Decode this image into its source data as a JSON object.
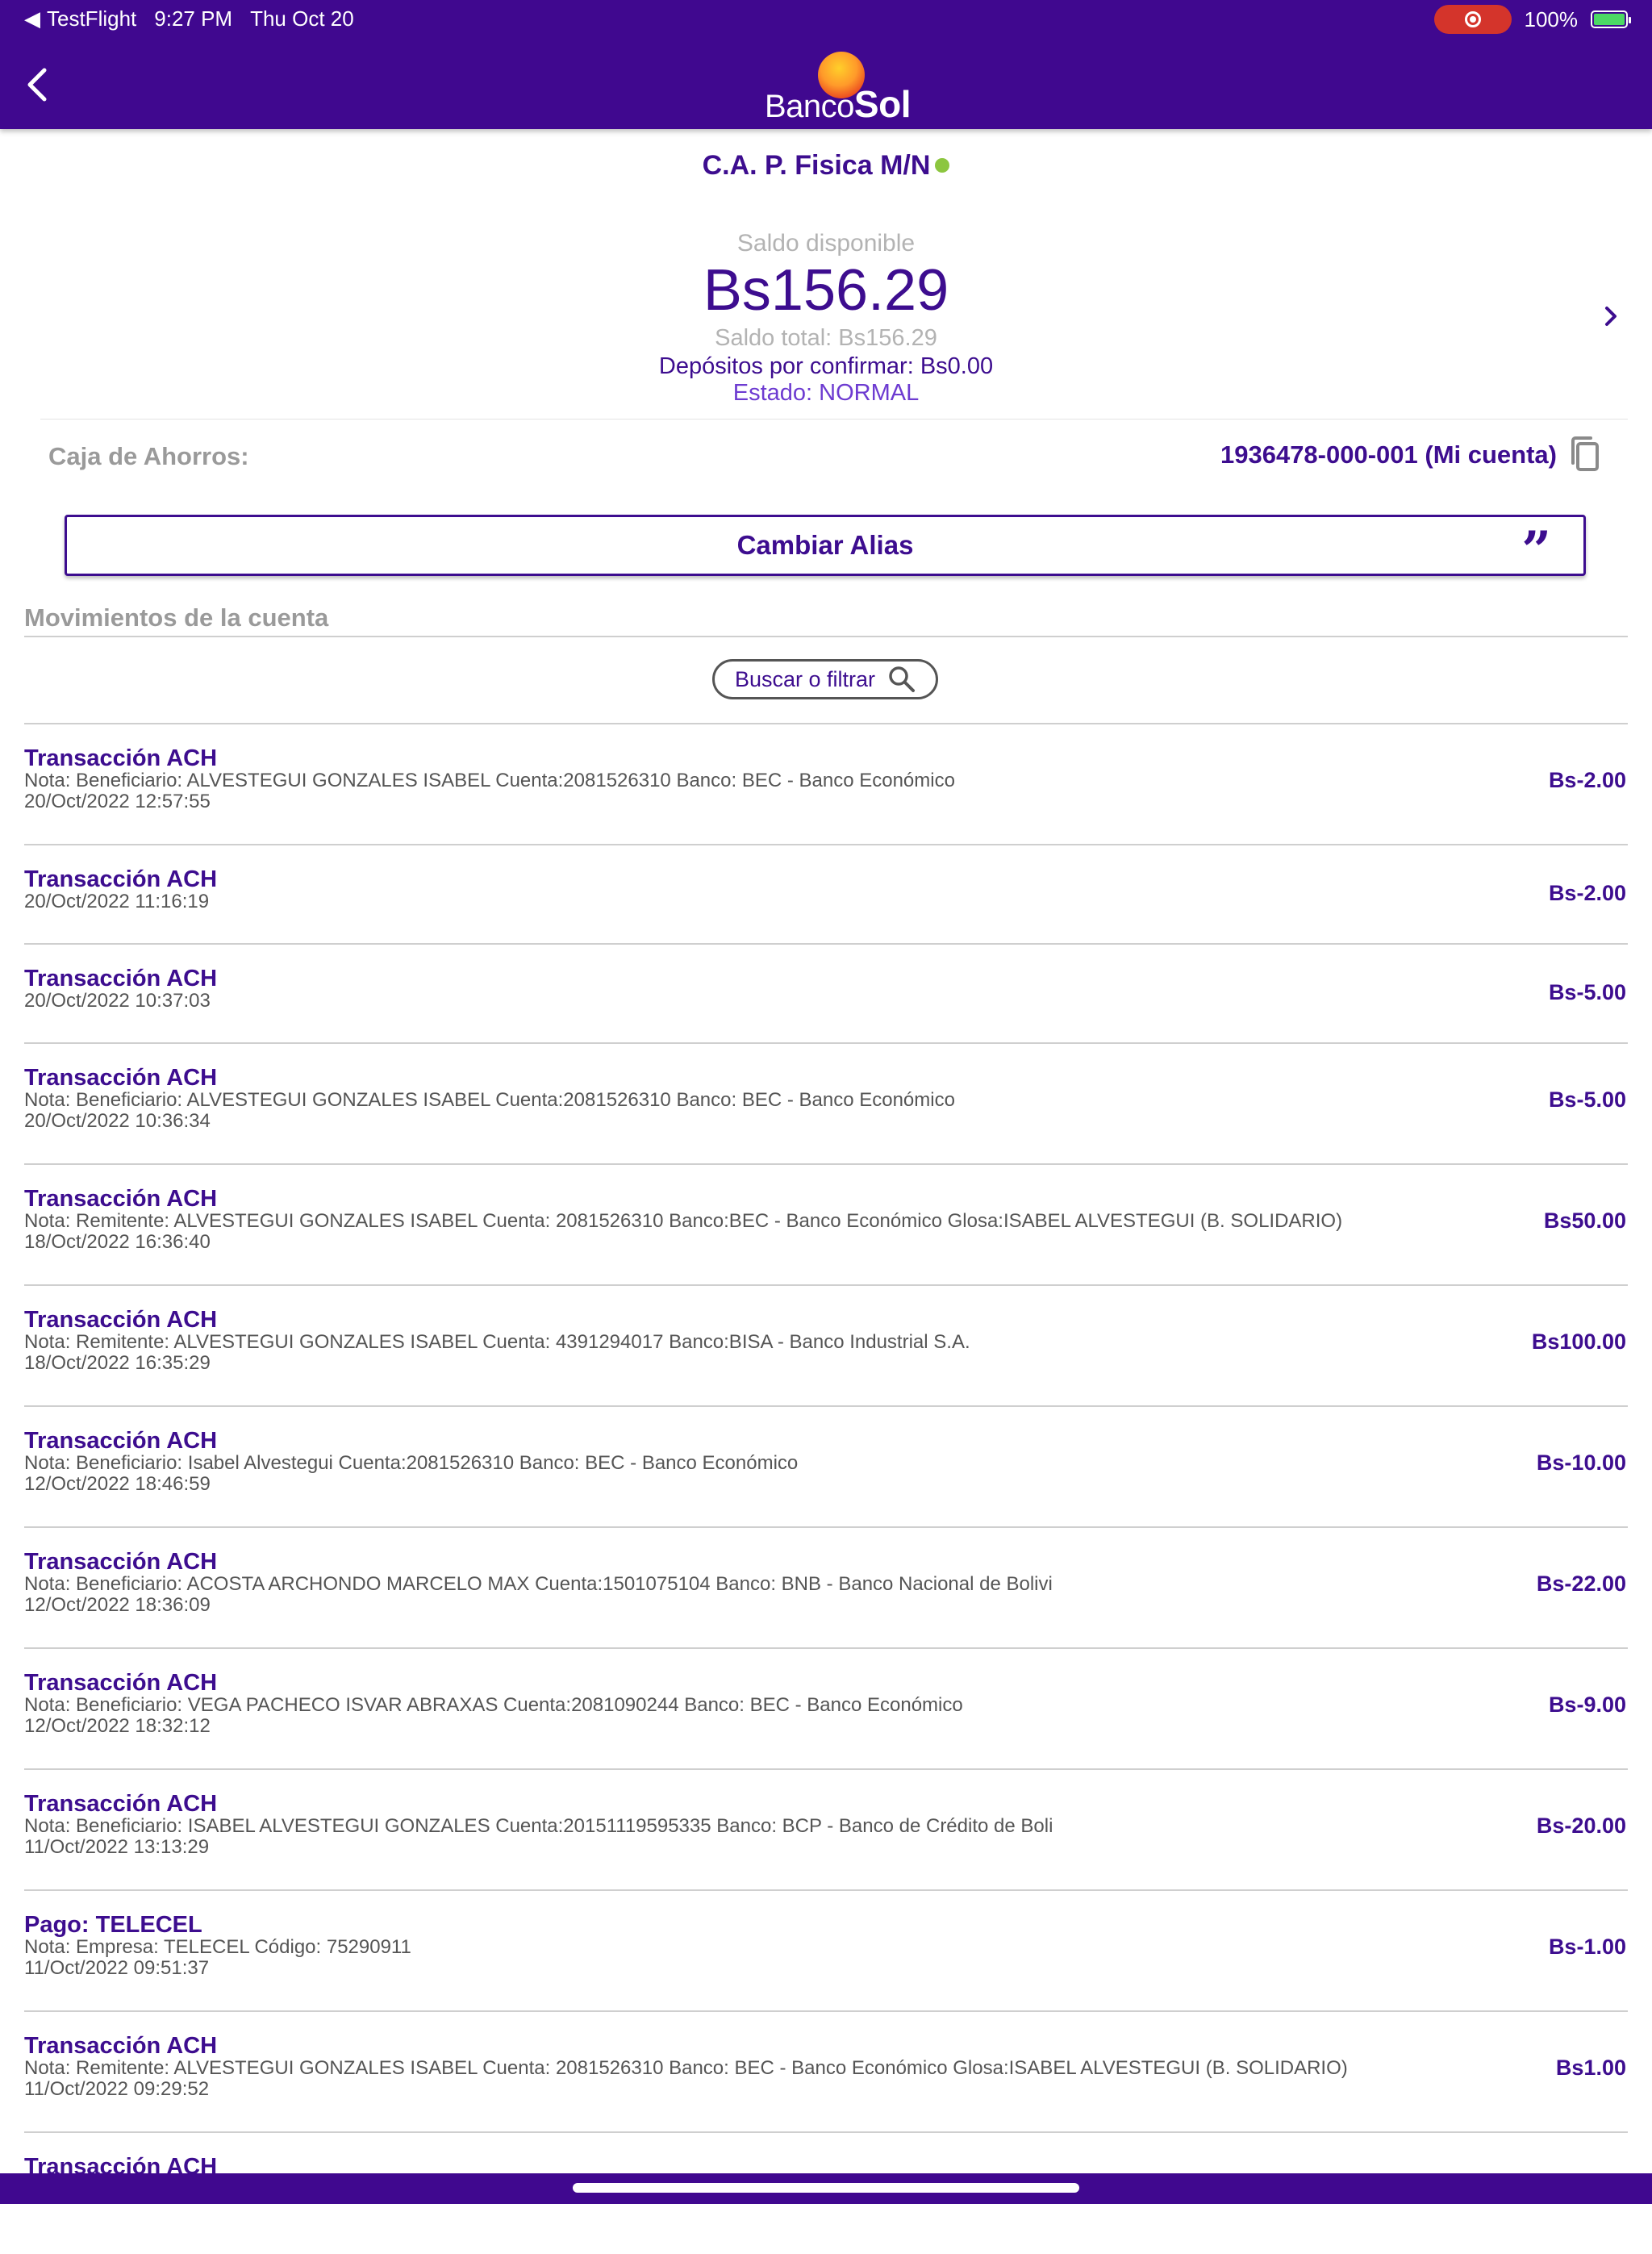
{
  "status_bar": {
    "back_app": "TestFlight",
    "time": "9:27 PM",
    "date": "Thu Oct 20",
    "battery": "100%"
  },
  "header": {
    "logo_text_light": "Banco",
    "logo_text_bold": "Sol"
  },
  "account": {
    "title": "C.A. P. Fisica M/N",
    "balance_label": "Saldo disponible",
    "balance": "Bs156.29",
    "total": "Saldo total: Bs156.29",
    "deposits": "Depósitos por confirmar: Bs0.00",
    "status": "Estado: NORMAL",
    "caja_label": "Caja de Ahorros:",
    "caja_value": "1936478-000-001 (Mi cuenta)",
    "alias_button": "Cambiar Alias"
  },
  "movements": {
    "title": "Movimientos de la cuenta",
    "search_label": "Buscar o filtrar",
    "items": [
      {
        "title": "Transacción ACH",
        "note": "Nota: Beneficiario: ALVESTEGUI GONZALES ISABEL Cuenta:2081526310 Banco: BEC - Banco Económico",
        "date": "20/Oct/2022 12:57:55",
        "amount": "Bs-2.00"
      },
      {
        "title": "Transacción ACH",
        "note": "",
        "date": "20/Oct/2022 11:16:19",
        "amount": "Bs-2.00"
      },
      {
        "title": "Transacción ACH",
        "note": "",
        "date": "20/Oct/2022 10:37:03",
        "amount": "Bs-5.00"
      },
      {
        "title": "Transacción ACH",
        "note": "Nota: Beneficiario: ALVESTEGUI GONZALES ISABEL Cuenta:2081526310 Banco: BEC - Banco Económico",
        "date": "20/Oct/2022 10:36:34",
        "amount": "Bs-5.00"
      },
      {
        "title": "Transacción ACH",
        "note": "Nota: Remitente: ALVESTEGUI GONZALES ISABEL Cuenta: 2081526310 Banco:BEC - Banco Económico Glosa:ISABEL ALVESTEGUI (B. SOLIDARIO)",
        "date": "18/Oct/2022 16:36:40",
        "amount": "Bs50.00"
      },
      {
        "title": "Transacción ACH",
        "note": "Nota: Remitente: ALVESTEGUI GONZALES ISABEL Cuenta: 4391294017 Banco:BISA - Banco Industrial S.A.",
        "date": "18/Oct/2022 16:35:29",
        "amount": "Bs100.00"
      },
      {
        "title": "Transacción ACH",
        "note": "Nota: Beneficiario: Isabel Alvestegui Cuenta:2081526310 Banco: BEC - Banco Económico",
        "date": "12/Oct/2022 18:46:59",
        "amount": "Bs-10.00"
      },
      {
        "title": "Transacción ACH",
        "note": "Nota: Beneficiario: ACOSTA ARCHONDO MARCELO MAX Cuenta:1501075104 Banco: BNB - Banco Nacional de Bolivi",
        "date": "12/Oct/2022 18:36:09",
        "amount": "Bs-22.00"
      },
      {
        "title": "Transacción ACH",
        "note": "Nota: Beneficiario: VEGA PACHECO ISVAR ABRAXAS Cuenta:2081090244 Banco: BEC - Banco Económico",
        "date": "12/Oct/2022 18:32:12",
        "amount": "Bs-9.00"
      },
      {
        "title": "Transacción ACH",
        "note": "Nota: Beneficiario: ISABEL ALVESTEGUI GONZALES Cuenta:20151119595335 Banco: BCP - Banco de Crédito de Boli",
        "date": "11/Oct/2022 13:13:29",
        "amount": "Bs-20.00"
      },
      {
        "title": "Pago: TELECEL",
        "note": "Nota: Empresa: TELECEL Código: 75290911",
        "date": "11/Oct/2022 09:51:37",
        "amount": "Bs-1.00"
      },
      {
        "title": "Transacción ACH",
        "note": "Nota: Remitente: ALVESTEGUI GONZALES ISABEL Cuenta: 2081526310 Banco: BEC - Banco Económico Glosa:ISABEL ALVESTEGUI (B. SOLIDARIO)",
        "date": "11/Oct/2022 09:29:52",
        "amount": "Bs1.00"
      },
      {
        "title": "Transacción ACH",
        "note": "",
        "date": "",
        "amount": ""
      }
    ]
  }
}
